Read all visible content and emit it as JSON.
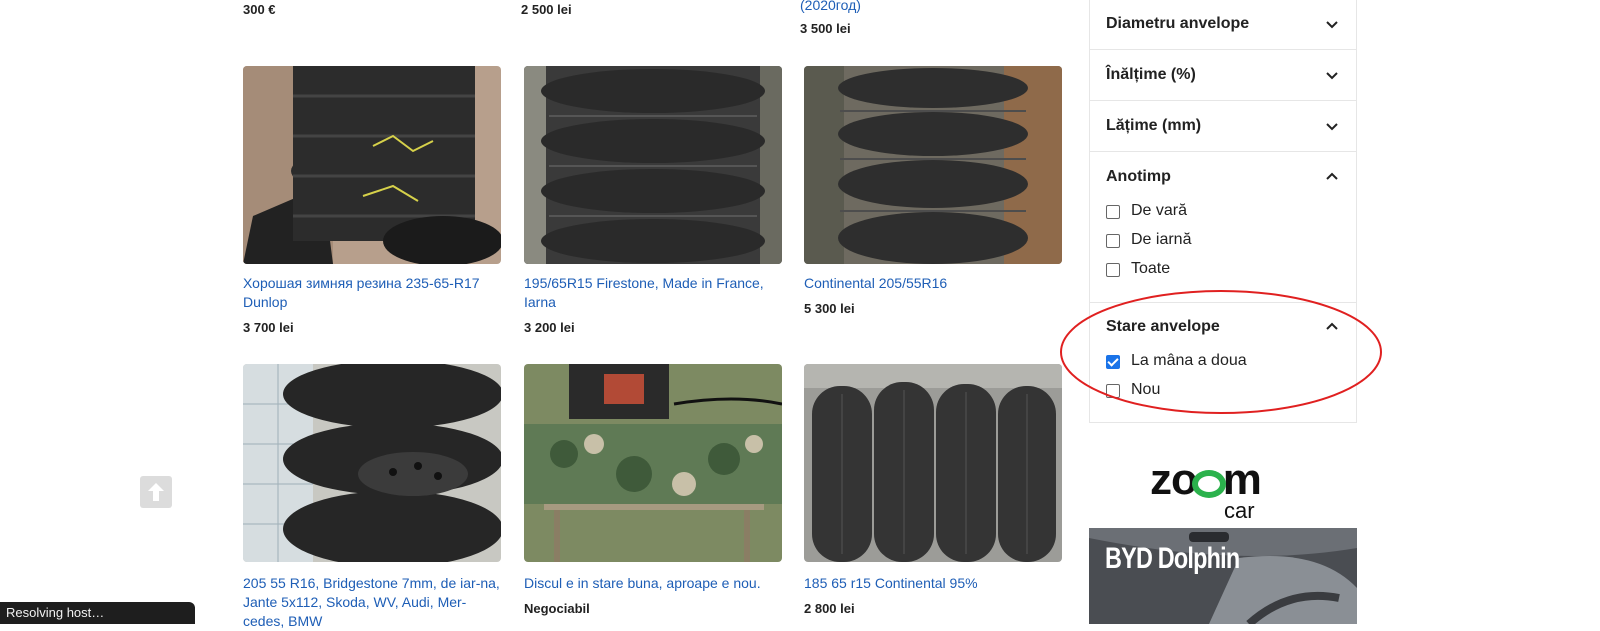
{
  "top_row": {
    "price_1": "300 €",
    "price_2": "2 500 lei",
    "title_3_tail": "(2020год)",
    "price_3": "3 500 lei"
  },
  "listings": [
    {
      "title": "Хорошая зимняя резина 235-65-R17 Dunlop",
      "price": "3 700 lei"
    },
    {
      "title": "195/65R15 Firestone, Made in France, Iarna",
      "price": "3 200 lei"
    },
    {
      "title": "Continental 205/55R16",
      "price": "5 300 lei"
    },
    {
      "title": "205 55 R16, Bridgestone 7mm, de iar-na, Jante 5x112, Skoda, WV, Audi, Mer-cedes, BMW",
      "price": ""
    },
    {
      "title": "Discul e in stare buna, aproape e nou.",
      "price": "Negociabil"
    },
    {
      "title": "185 65 r15 Continental 95%",
      "price": "2 800 lei"
    }
  ],
  "filters": {
    "diametru": "Diametru anvelope",
    "inaltime": "Înălțime (%)",
    "latime": "Lățime (mm)",
    "anotimp": {
      "label": "Anotimp",
      "options": [
        "De vară",
        "De iarnă",
        "Toate"
      ]
    },
    "stare": {
      "label": "Stare anvelope",
      "options": [
        "La mâna a doua",
        "Nou"
      ],
      "checked": "La mâna a doua"
    }
  },
  "ads": {
    "zoom_logo_top": "zoom",
    "zoom_logo_bottom": "car",
    "byd_text": "BYD Dolphin"
  },
  "status_bar": "Resolving host…",
  "colors": {
    "link": "#1e5eb6",
    "checkbox_checked": "#1a73e8",
    "highlight_circle": "#e02020",
    "zoom_green": "#2bb24c"
  }
}
